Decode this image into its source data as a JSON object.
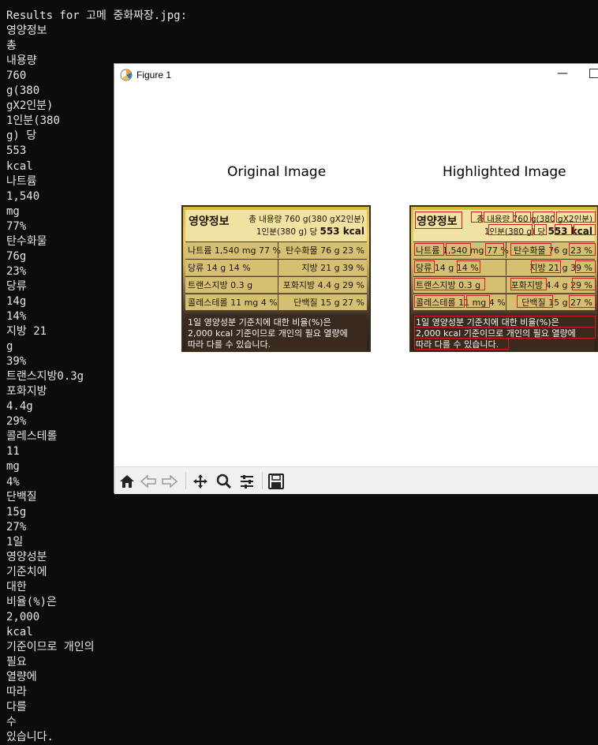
{
  "terminal": {
    "lines": [
      "",
      "Results for 고메 중화짜장.jpg:",
      "영양정보",
      "총",
      "내용량",
      "760",
      "g(380",
      "gX2인분)",
      "1인분(380",
      "g) 당",
      "553",
      "kcal",
      "나트륨",
      "1,540",
      "mg",
      "77%",
      "탄수화물",
      "76g",
      "23%",
      "당류",
      "14g",
      "14%",
      "지방 21",
      "g",
      "39%",
      "트랜스지방0.3g",
      "포화지방",
      "4.4g",
      "29%",
      "콜레스테롤",
      "11",
      "mg",
      "4%",
      "단백질",
      "15g",
      "27%",
      "1일",
      "영양성분",
      "기준치에",
      "대한",
      "비율(%)은",
      "2,000",
      "kcal",
      "기준이므로 개인의",
      "필요",
      "열량에",
      "따라",
      "다를",
      "수",
      "있습니다."
    ]
  },
  "window": {
    "title": "Figure 1",
    "min_symbol": "—",
    "icons": [
      "matplotlib-icon",
      "minimize-icon",
      "maximize-icon"
    ]
  },
  "figure": {
    "orig_title": "Original Image",
    "hl_title": "Highlighted Image",
    "label": {
      "head": "영양정보",
      "total": "총 내용량 760 g(380 gX2인분)",
      "serving": "1인분(380 g) 당",
      "kcal": "553 kcal",
      "rows": [
        {
          "l": "나트륨 1,540 mg 77 %",
          "r": "탄수화물 76 g 23 %"
        },
        {
          "l": "당류 14 g 14 %",
          "r": "지방 21 g 39 %"
        },
        {
          "l": "트랜스지방 0.3 g",
          "r": "포화지방 4.4 g 29 %"
        },
        {
          "l": "콜레스테롤 11 mg 4 %",
          "r": "단백질 15 g 27 %"
        }
      ],
      "foot1": "1일 영양성분 기준치에 대한 비율(%)은",
      "foot2": "2,000 kcal 기준이므로 개인의 필요 열량에",
      "foot3": "따라 다를 수 있습니다."
    }
  },
  "toolbar": {
    "buttons": [
      "home-icon",
      "back-icon",
      "forward-icon",
      "pan-icon",
      "zoom-icon",
      "configure-subplots-icon",
      "save-icon"
    ]
  },
  "colors": {
    "box": "#d41a1a",
    "terminal_bg": "#0c0c0c"
  }
}
